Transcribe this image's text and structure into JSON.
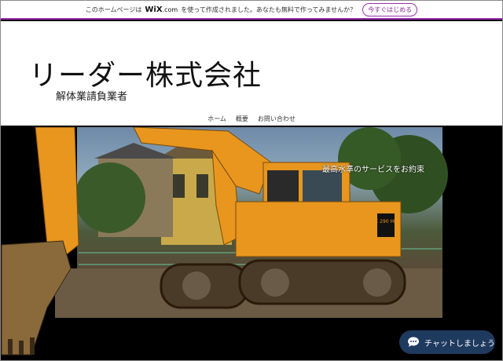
{
  "promo": {
    "text_before": "このホームページは",
    "logo": "WiX",
    "logo_domain": ".com",
    "text_after": "を使って作成されました。あなたも無料で作ってみませんか？",
    "button": "今すぐはじめる"
  },
  "header": {
    "title": "リーダー株式会社",
    "subtitle": "解体業請負業者"
  },
  "nav": {
    "items": [
      "ホーム",
      "概要",
      "お問い合わせ"
    ]
  },
  "hero": {
    "caption": "最高水準のサービスをお約束",
    "machine_label": "PC 290 HLC"
  },
  "chat": {
    "label": "チャットしましょう"
  },
  "colors": {
    "accent": "#9b2fae",
    "machine_orange": "#e8961e",
    "chat_bg": "#1f3a5f"
  }
}
